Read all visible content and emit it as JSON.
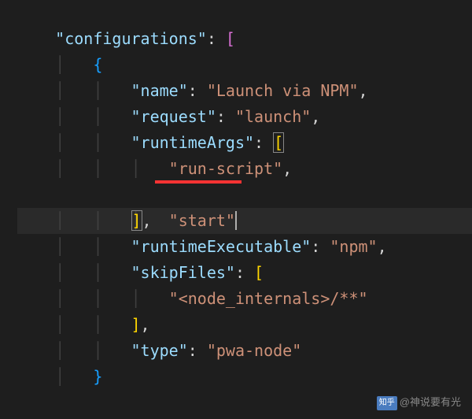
{
  "code": {
    "key_configurations": "\"configurations\"",
    "bracket_open": "[",
    "brace_open": "{",
    "key_name": "\"name\"",
    "val_name": "\"Launch via NPM\"",
    "key_request": "\"request\"",
    "val_request": "\"launch\"",
    "key_runtimeArgs": "\"runtimeArgs\"",
    "runtimeArgs_open": "[",
    "val_runscript": "\"run-script\"",
    "val_start": "\"start\"",
    "runtimeArgs_close": "]",
    "key_runtimeExecutable": "\"runtimeExecutable\"",
    "val_runtimeExecutable": "\"npm\"",
    "key_skipFiles": "\"skipFiles\"",
    "skipFiles_open": "[",
    "val_nodeinternals": "\"<node_internals>/**\"",
    "skipFiles_close": "]",
    "key_type": "\"type\"",
    "val_type": "\"pwa-node\"",
    "brace_close": "}",
    "colon": ":",
    "comma": ","
  },
  "watermark": {
    "icon": "知乎",
    "text": "@神说要有光"
  }
}
